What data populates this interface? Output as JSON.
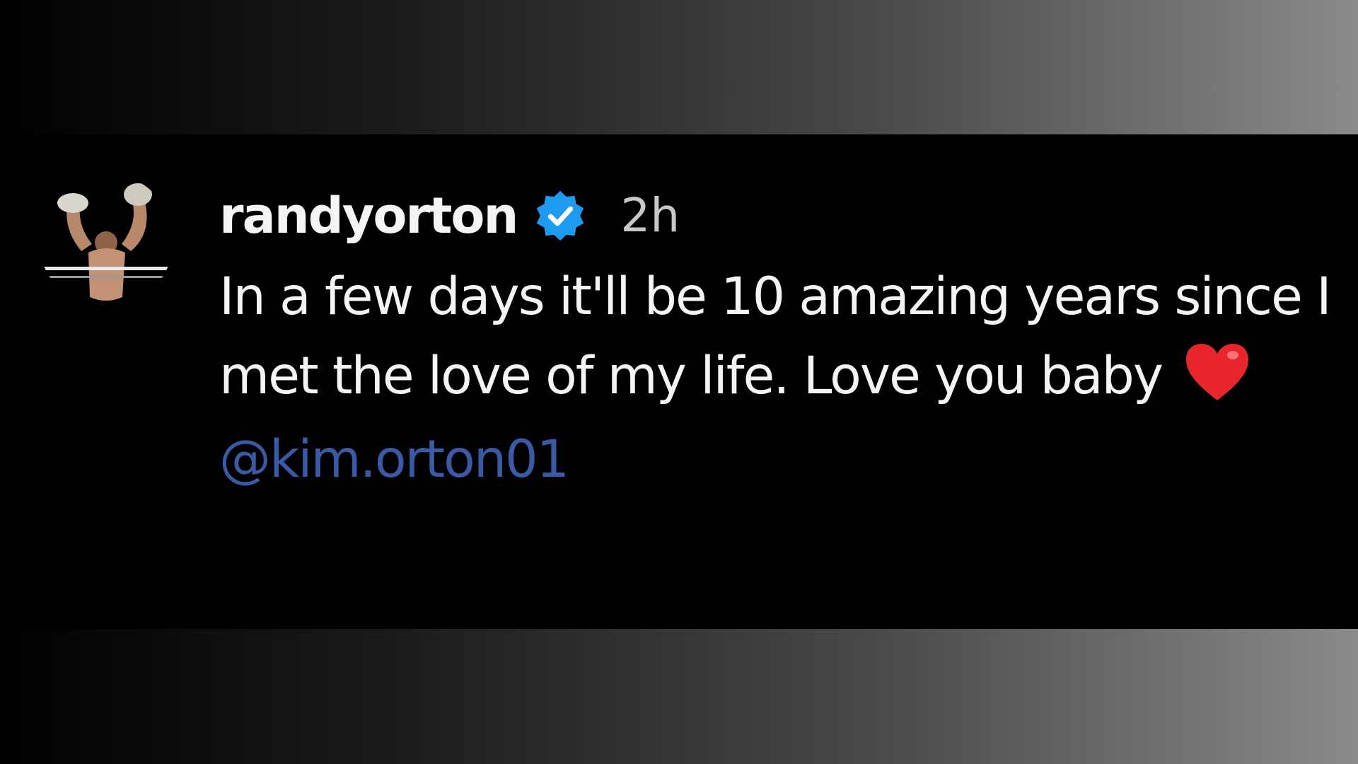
{
  "post": {
    "username": "randyorton",
    "timestamp": "2h",
    "caption": "In a few days it'll be 10 amazing years since I met the love of my life. Love you baby",
    "mention": "@kim.orton01"
  },
  "icons": {
    "verified": "verified-badge-icon",
    "heart": "red-heart-emoji"
  },
  "colors": {
    "card_background": "#000000",
    "text": "#f4f4f4",
    "timestamp": "#c8c8c8",
    "mention": "#3b5aa6",
    "verified_badge": "#1d9bf0",
    "heart": "#e8262c"
  }
}
